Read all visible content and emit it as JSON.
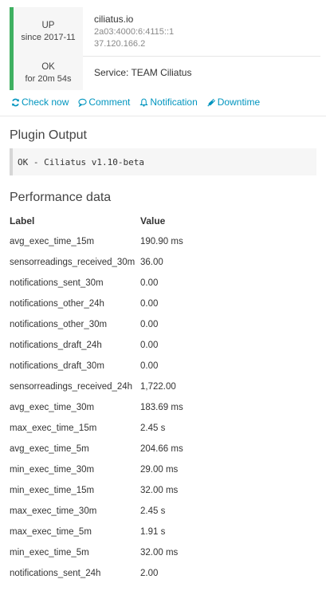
{
  "host_row": {
    "state": "UP",
    "since": "since 2017-11",
    "name": "ciliatus.io",
    "address_v6": "2a03:4000:6:4115::1",
    "address_v4": "37.120.166.2"
  },
  "service_row": {
    "state": "OK",
    "duration": "for 20m 54s",
    "label": "Service: TEAM Ciliatus"
  },
  "status_color": "#3fb061",
  "link_color": "#0095bf",
  "actions": [
    {
      "label": "Check now",
      "icon": "refresh-icon"
    },
    {
      "label": "Comment",
      "icon": "comment-icon"
    },
    {
      "label": "Notification",
      "icon": "bell-icon"
    },
    {
      "label": "Downtime",
      "icon": "plug-icon"
    }
  ],
  "plugin_output": {
    "title": "Plugin Output",
    "text": "OK - Ciliatus v1.10-beta"
  },
  "performance": {
    "title": "Performance data",
    "col_label": "Label",
    "col_value": "Value",
    "rows": [
      {
        "label": "avg_exec_time_15m",
        "value": "190.90 ms"
      },
      {
        "label": "sensorreadings_received_30m",
        "value": "36.00"
      },
      {
        "label": "notifications_sent_30m",
        "value": "0.00"
      },
      {
        "label": "notifications_other_24h",
        "value": "0.00"
      },
      {
        "label": "notifications_other_30m",
        "value": "0.00"
      },
      {
        "label": "notifications_draft_24h",
        "value": "0.00"
      },
      {
        "label": "notifications_draft_30m",
        "value": "0.00"
      },
      {
        "label": "sensorreadings_received_24h",
        "value": "1,722.00"
      },
      {
        "label": "avg_exec_time_30m",
        "value": "183.69 ms"
      },
      {
        "label": "max_exec_time_15m",
        "value": "2.45 s"
      },
      {
        "label": "avg_exec_time_5m",
        "value": "204.66 ms"
      },
      {
        "label": "min_exec_time_30m",
        "value": "29.00 ms"
      },
      {
        "label": "min_exec_time_15m",
        "value": "32.00 ms"
      },
      {
        "label": "max_exec_time_30m",
        "value": "2.45 s"
      },
      {
        "label": "max_exec_time_5m",
        "value": "1.91 s"
      },
      {
        "label": "min_exec_time_5m",
        "value": "32.00 ms"
      },
      {
        "label": "notifications_sent_24h",
        "value": "2.00"
      }
    ]
  }
}
